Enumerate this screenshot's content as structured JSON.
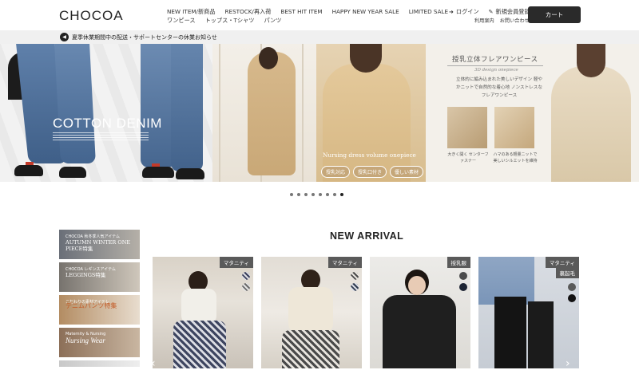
{
  "header": {
    "logo": "CHOCOA",
    "nav_row1": [
      "NEW ITEM/新商品",
      "RESTOCK/再入荷",
      "BEST HIT ITEM",
      "HAPPY NEW YEAR SALE",
      "LIMITED SALE"
    ],
    "nav_row2": [
      "ワンピース",
      "トップス・Tシャツ",
      "パンツ"
    ],
    "login": "ログイン",
    "register": "新規会員登録",
    "guide": "利用案内",
    "contact": "お問い合わせ",
    "cart": "カート"
  },
  "notice": {
    "text": "夏季休業期間中の配送・サポートセンターの休業お知らせ"
  },
  "hero": {
    "slide1_title": "COTTON DENIM",
    "slide2_caption": "Nursing dress volume onepiece",
    "slide2_tags": [
      "授乳対応",
      "授乳口付き",
      "優しい素材"
    ],
    "slide3_title": "授乳立体フレアワンピース",
    "slide3_subtitle": "3D design onepiece",
    "slide3_body": "立体的に編み込まれた美しいデザイン 軽やかニットで自然的な着心地 ノンストレスなフレアワンピース",
    "slide3_caption1": "大きく開く センターファスナー",
    "slide3_caption2": "ハマのある軽量ニットで 美しいシルエットを維持"
  },
  "carousel": {
    "dot_count": 8,
    "active_index": 7
  },
  "side_banners": [
    {
      "small": "CHOCOA 秋冬季人気アイテム",
      "title": "AUTUMN WINTER ONE PIECE特集"
    },
    {
      "small": "CHOCOA レギンスアイテム",
      "title": "LEGGINGS特集"
    },
    {
      "small": "こだわりの素材アイテム",
      "title": "デニムパンツ特集"
    },
    {
      "small": "Maternity & Nursing",
      "title": "Nursing Wear"
    },
    {
      "small": "",
      "title": ""
    }
  ],
  "new_arrival": {
    "heading": "NEW ARRIVAL",
    "products": [
      {
        "badge": "マタニティ",
        "badge2": "",
        "colors": [
          "#3a3f5c",
          "#6a6a6a"
        ]
      },
      {
        "badge": "マタニティ",
        "badge2": "",
        "colors": [
          "#4a4a4a",
          "#2f3a4f"
        ]
      },
      {
        "badge": "授乳服",
        "badge2": "",
        "colors": [
          "#4b4b4b",
          "#1d2433"
        ]
      },
      {
        "badge": "マタニティ",
        "badge2": "裏起毛",
        "colors": [
          "#5a5a5a",
          "#111111"
        ]
      }
    ]
  }
}
